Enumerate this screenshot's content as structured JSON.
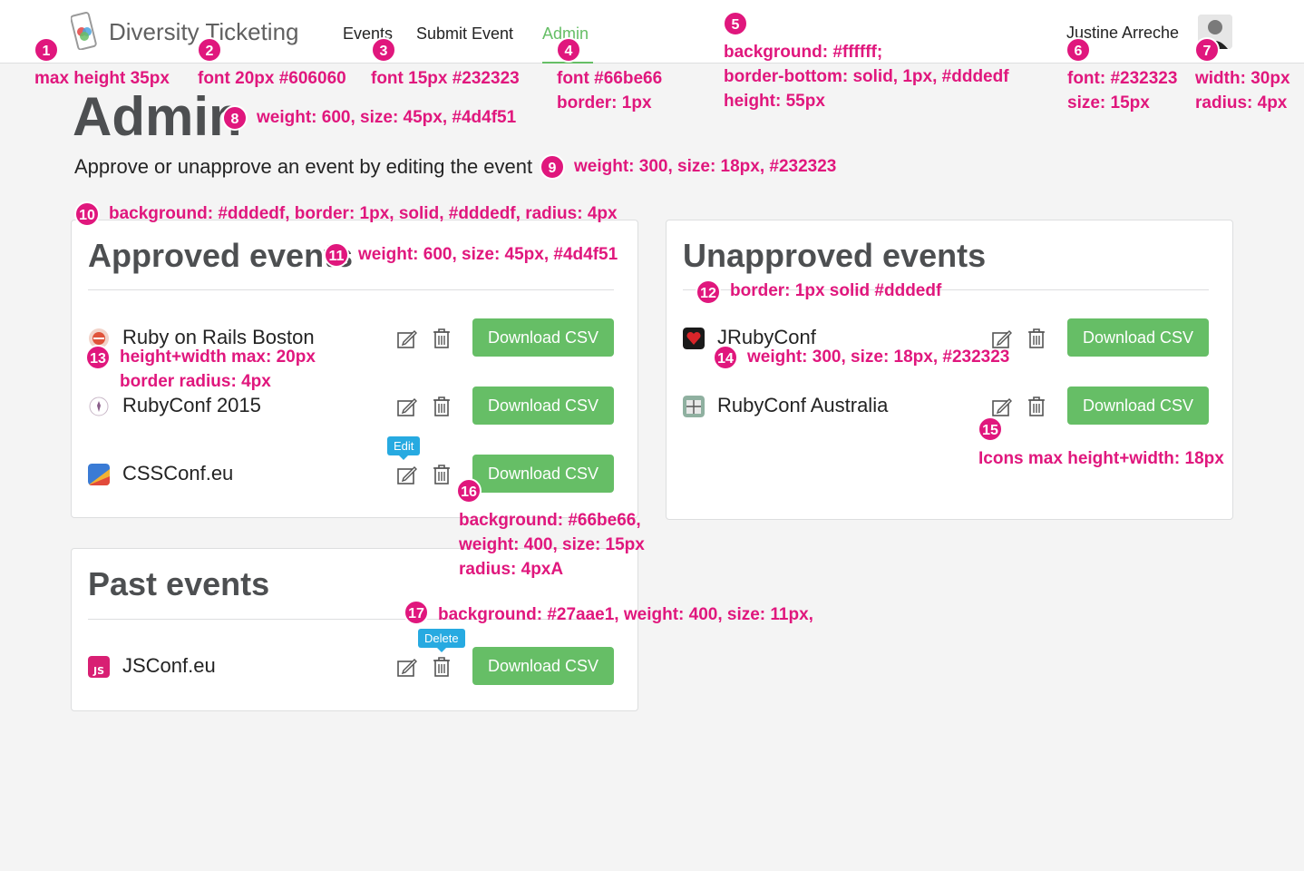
{
  "header": {
    "brand": "Diversity Ticketing",
    "nav": [
      "Events",
      "Submit Event",
      "Admin"
    ],
    "user_name": "Justine Arreche"
  },
  "page": {
    "title": "Admin",
    "subtitle": "Approve or unapprove an event by editing the event"
  },
  "approved": {
    "title": "Approved events",
    "events": [
      "Ruby on Rails Boston",
      "RubyConf 2015",
      "CSSConf.eu"
    ]
  },
  "unapproved": {
    "title": "Unapproved events",
    "events": [
      "JRubyConf",
      "RubyConf Australia"
    ]
  },
  "past": {
    "title": "Past events",
    "events": [
      "JSConf.eu"
    ]
  },
  "buttons": {
    "csv": "Download CSV"
  },
  "tooltips": {
    "edit": "Edit",
    "delete": "Delete"
  },
  "colors": {
    "accent": "#66be66",
    "tooltip": "#27aae1",
    "heading": "#4d4f51",
    "text": "#232323",
    "border": "#dddedf",
    "annotation": "#e0177d"
  },
  "annotations": {
    "n1": "max height 35px",
    "n2": "font 20px #606060",
    "n3": "font 15px #232323",
    "n4": [
      "font #66be66",
      "border: 1px"
    ],
    "n5": [
      "background: #ffffff;",
      "border-bottom: solid, 1px, #dddedf",
      "height: 55px"
    ],
    "n6": [
      "font: #232323",
      "size: 15px"
    ],
    "n7": [
      "width: 30px",
      "radius: 4px"
    ],
    "n8": "weight: 600, size: 45px, #4d4f51",
    "n9": "weight: 300, size: 18px, #232323",
    "n10": "background: #dddedf, border: 1px, solid, #dddedf, radius: 4px",
    "n11": "weight: 600, size: 45px, #4d4f51",
    "n12": "border: 1px solid #dddedf",
    "n13": [
      "height+width max: 20px",
      "border radius: 4px"
    ],
    "n14": "weight: 300, size: 18px, #232323",
    "n15": "Icons max height+width: 18px",
    "n16": [
      "background: #66be66,",
      "weight: 400, size: 15px",
      "radius: 4pxA"
    ],
    "n17": "background: #27aae1, weight: 400, size: 11px,"
  }
}
